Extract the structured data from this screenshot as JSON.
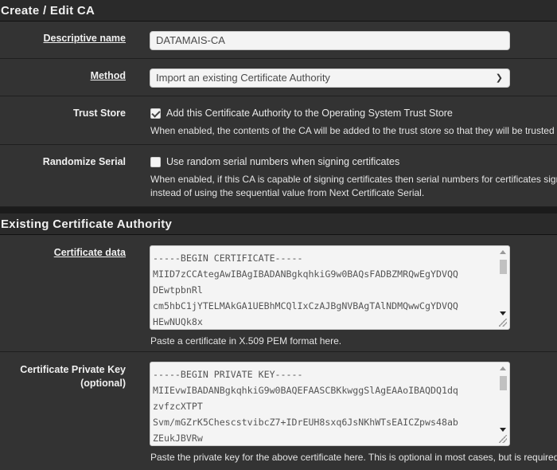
{
  "create_section": {
    "heading": "Create / Edit CA",
    "descriptive_name": {
      "label": "Descriptive name",
      "value": "DATAMAIS-CA"
    },
    "method": {
      "label": "Method",
      "selected": "Import an existing Certificate Authority"
    },
    "trust_store": {
      "label": "Trust Store",
      "checked": true,
      "checkbox_label": "Add this Certificate Authority to the Operating System Trust Store",
      "help": "When enabled, the contents of the CA will be added to the trust store so that they will be trusted"
    },
    "randomize_serial": {
      "label": "Randomize Serial",
      "checked": false,
      "checkbox_label": "Use random serial numbers when signing certificates",
      "help_line1": "When enabled, if this CA is capable of signing certificates then serial numbers for certificates sign",
      "help_line2": "instead of using the sequential value from Next Certificate Serial."
    }
  },
  "existing_section": {
    "heading": "Existing Certificate Authority",
    "certificate_data": {
      "label": "Certificate data",
      "lines": [
        "-----BEGIN CERTIFICATE-----",
        "MIID7zCCAtegAwIBAgIBADANBgkqhkiG9w0BAQsFADBZMRQwEgYDVQQ",
        "DEwtpbnRl",
        "cm5hbC1jYTELMAkGA1UEBhMCQlIxCzAJBgNVBAgTAlNDMQwwCgYDVQQ",
        "HEwNUQk8x"
      ],
      "help": "Paste a certificate in X.509 PEM format here."
    },
    "private_key": {
      "label_line1": "Certificate Private Key",
      "label_line2": "(optional)",
      "lines": [
        "-----BEGIN PRIVATE KEY-----",
        "MIIEvwIBADANBgkqhkiG9w0BAQEFAASCBKkwggSlAgEAAoIBAQDQ1dq",
        "zvfzcXTPT",
        "Svm/mGZrK5ChescstvibcZ7+IDrEUH8sxq6JsNKhWTsEAICZpws48ab",
        "ZEukJBVRw"
      ],
      "help": "Paste the private key for the above certificate here. This is optional in most cases, but is required"
    }
  }
}
